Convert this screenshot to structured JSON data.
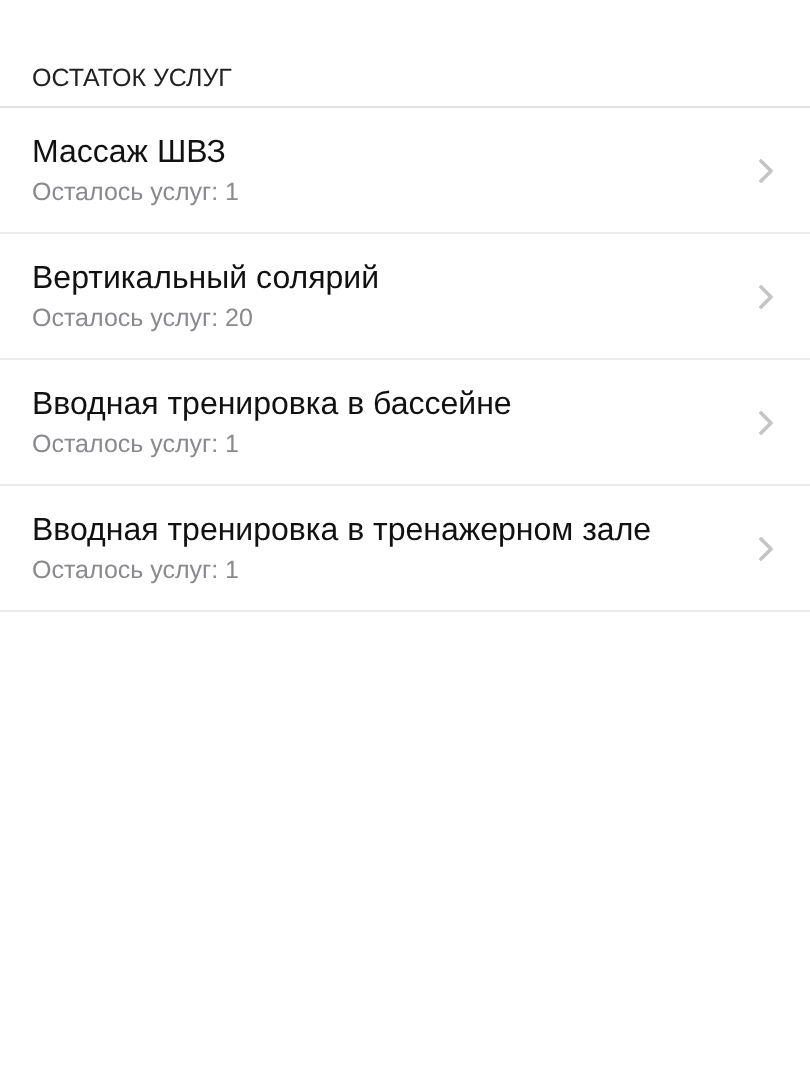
{
  "section_title": "ОСТАТОК УСЛУГ",
  "services": [
    {
      "name": "Массаж ШВЗ",
      "remaining": "Осталось услуг: 1"
    },
    {
      "name": "Вертикальный солярий",
      "remaining": "Осталось услуг: 20"
    },
    {
      "name": "Вводная тренировка в бассейне",
      "remaining": "Осталось услуг: 1"
    },
    {
      "name": "Вводная тренировка в тренажерном зале",
      "remaining": "Осталось услуг: 1"
    }
  ]
}
